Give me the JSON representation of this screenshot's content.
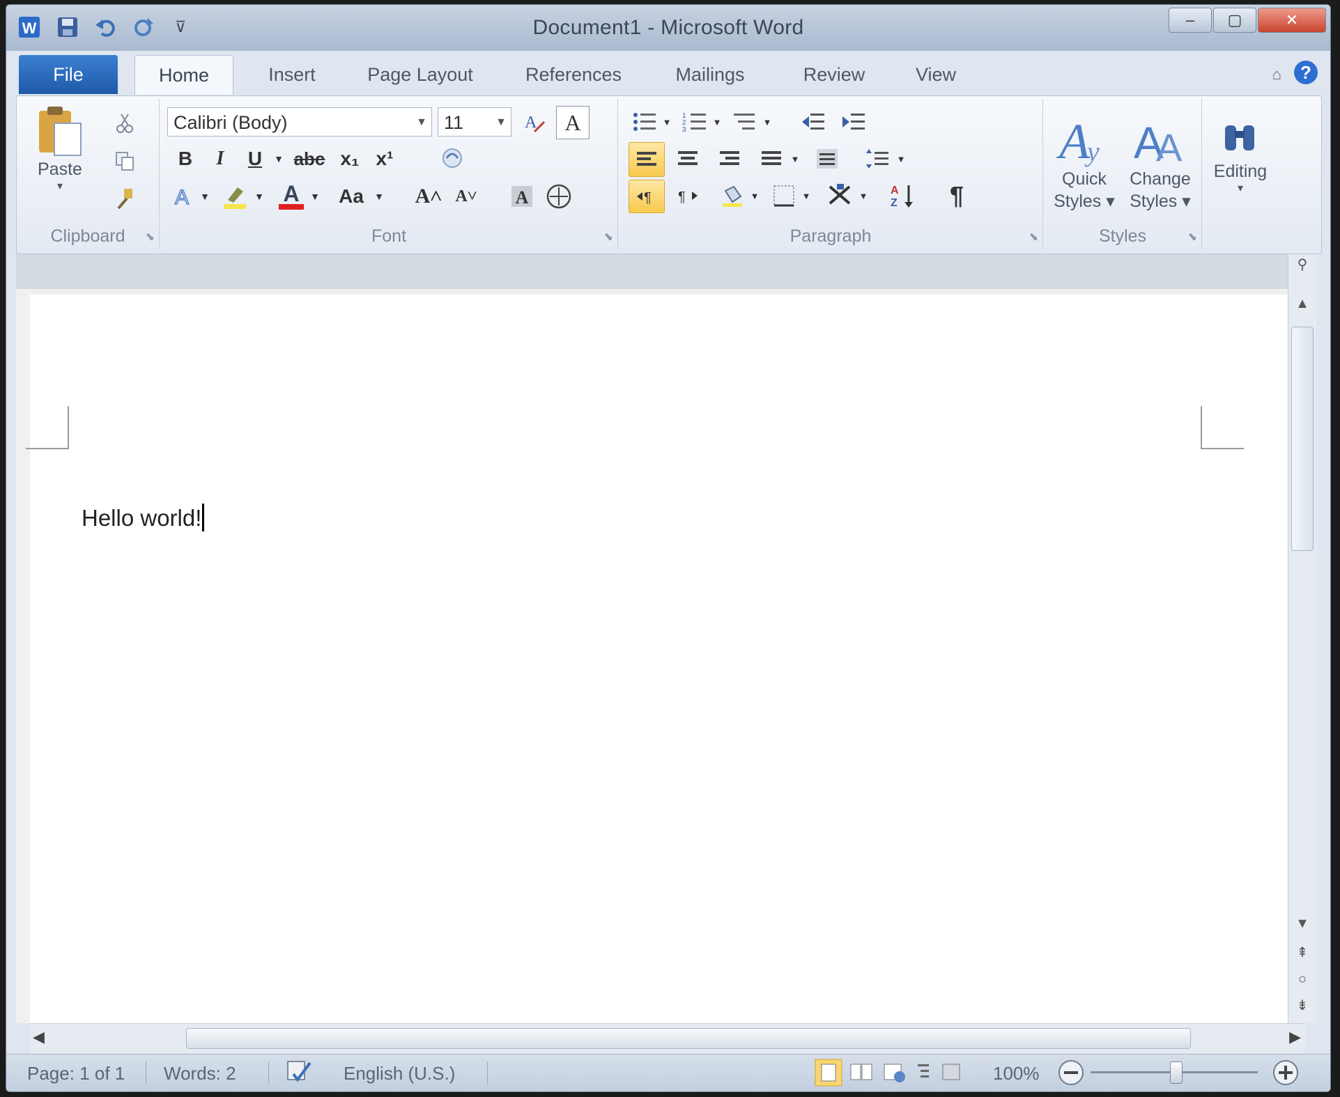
{
  "window": {
    "title": "Document1 - Microsoft Word",
    "controls": {
      "minimize": "–",
      "maximize": "▢",
      "close": "✕"
    }
  },
  "qat": {
    "customize": "⊽"
  },
  "tabs": [
    {
      "label": "File"
    },
    {
      "label": "Home"
    },
    {
      "label": "Insert"
    },
    {
      "label": "Page Layout"
    },
    {
      "label": "References"
    },
    {
      "label": "Mailings"
    },
    {
      "label": "Review"
    },
    {
      "label": "View"
    }
  ],
  "ribbon": {
    "clipboard": {
      "paste": "Paste",
      "group": "Clipboard"
    },
    "font": {
      "name": "Calibri (Body)",
      "size": "11",
      "group": "Font",
      "bold": "B",
      "italic": "I",
      "underline": "U",
      "strike": "abc",
      "subscript": "x₁",
      "superscript": "x¹",
      "textcolor": "A",
      "changecase": "Aa",
      "grow": "A˄",
      "shrink": "A˅"
    },
    "paragraph": {
      "group": "Paragraph",
      "pilcrow": "¶"
    },
    "styles": {
      "quick": "Quick Styles ▾",
      "change": "Change Styles ▾",
      "group": "Styles"
    },
    "editing": {
      "label": "Editing"
    }
  },
  "document": {
    "text": "Hello world!"
  },
  "status": {
    "page": "Page: 1 of 1",
    "words": "Words: 2",
    "language": "English (U.S.)",
    "zoom": "100%"
  }
}
